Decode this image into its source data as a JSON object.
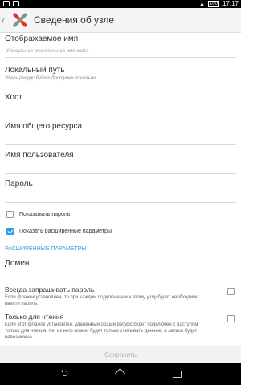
{
  "status_bar": {
    "time": "17:17",
    "battery": "100"
  },
  "action_bar": {
    "title": "Сведения об узле",
    "icon": "tools-icon"
  },
  "form": {
    "display_name": {
      "label": "Отображаемое имя",
      "placeholder": "Уникальное описательное имя хоста"
    },
    "local_path": {
      "label": "Локальный путь",
      "hint": "Здесь ресурс будет доступен локально"
    },
    "host": {
      "label": "Хост"
    },
    "share_name": {
      "label": "Имя общего ресурса"
    },
    "username": {
      "label": "Имя пользователя"
    },
    "password": {
      "label": "Пароль"
    },
    "show_password": {
      "label": "Показывать пароль",
      "checked": false
    },
    "show_advanced": {
      "label": "Показать расширенные параметры",
      "checked": true
    }
  },
  "advanced": {
    "header": "РАСШИРЕННЫЕ ПАРАМЕТРЫ",
    "domain": {
      "label": "Домен"
    },
    "always_ask_password": {
      "label": "Всегда запрашивать пароль",
      "description": "Если флажок установлен, то при каждом подключении к этому узлу будет необходимо ввести пароль.",
      "checked": false
    },
    "read_only": {
      "label": "Только для чтения",
      "description": "Если этот флажок установлен, удаленный общий ресурс будет подключен с доступом только для чтения, т.е. из него можно будет только считывать данные, а запись будет невозможна.",
      "checked": false
    }
  },
  "footer": {
    "save_label": "Сохранить"
  },
  "nav": {
    "back": "back-icon",
    "home": "home-icon",
    "recents": "recents-icon"
  }
}
